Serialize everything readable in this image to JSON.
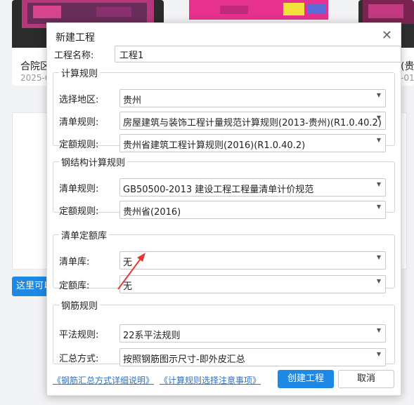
{
  "background": {
    "cards": [
      {
        "title": "合院区",
        "date": "2025-0"
      },
      {
        "title": "",
        "date": ""
      },
      {
        "title": "(贵",
        "date": "-01"
      }
    ],
    "side_button_label": "这里可以"
  },
  "dialog": {
    "title": "新建工程",
    "close_icon": "close-icon",
    "project_name": {
      "label": "工程名称:",
      "value": "工程1"
    },
    "calc_rules": {
      "legend": "计算规则",
      "region": {
        "label": "选择地区:",
        "value": "贵州"
      },
      "bill_rule": {
        "label": "清单规则:",
        "value": "房屋建筑与装饰工程计量规范计算规则(2013-贵州)(R1.0.40.2)"
      },
      "quota_rule": {
        "label": "定额规则:",
        "value": "贵州省建筑工程计算规则(2016)(R1.0.40.2)"
      }
    },
    "steel_rules": {
      "legend": "钢结构计算规则",
      "bill_rule": {
        "label": "清单规则:",
        "value": "GB50500-2013 建设工程工程量清单计价规范"
      },
      "quota_rule": {
        "label": "定额规则:",
        "value": "贵州省(2016)"
      }
    },
    "quota_lib": {
      "legend": "清单定额库",
      "bill_lib": {
        "label": "清单库:",
        "value": "无"
      },
      "quota_lib": {
        "label": "定额库:",
        "value": "无"
      }
    },
    "rebar_rules": {
      "legend": "钢筋规则",
      "flat_rule": {
        "label": "平法规则:",
        "value": "22系平法规则"
      },
      "summary": {
        "label": "汇总方式:",
        "value": "按照钢筋图示尺寸-即外皮汇总"
      }
    },
    "links": {
      "rebar_summary": "《钢筋汇总方式详细说明》",
      "calc_rule_notes": "《计算规则选择注意事项》"
    },
    "buttons": {
      "create": "创建工程",
      "cancel": "取消"
    }
  },
  "colors": {
    "primary": "#1e88e5",
    "link": "#2f72c4",
    "annotation": "#e53935"
  }
}
